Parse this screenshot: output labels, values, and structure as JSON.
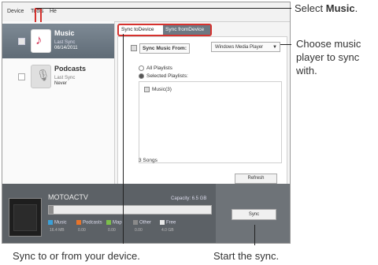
{
  "menu": [
    "Device",
    "Tools",
    "He"
  ],
  "sidebar": {
    "items": [
      {
        "title": "Music",
        "line1": "Last Sync",
        "line2": "06/14/2011"
      },
      {
        "title": "Podcasts",
        "line1": "Last Sync",
        "line2": "Never"
      }
    ]
  },
  "tabs": {
    "to_device": "Sync toDevice",
    "from_device": "Sync fromDevice"
  },
  "sync_panel": {
    "sync_from_label": "Sync Music From:",
    "player_value": "Windows Media Player",
    "all_playlists": "All Playlists",
    "selected_playlists": "Selected Playlists:",
    "playlist_item": "Music(3)",
    "song_count": "3 Songs",
    "refresh_button": "Refresh"
  },
  "device": {
    "name": "MOTOACTV",
    "capacity": "Capacity: 6.5 GB",
    "usage_fraction": 0.03,
    "legend": [
      {
        "label": "Music",
        "size": "16.4 MB",
        "color": "#3aa0d8"
      },
      {
        "label": "Podcasts",
        "size": "0.00",
        "color": "#e8742a"
      },
      {
        "label": "Map",
        "size": "0.00",
        "color": "#7cc04b"
      },
      {
        "label": "Other",
        "size": "0.00",
        "color": "#8a8a8a"
      },
      {
        "label": "Free",
        "size": "4.0 GB",
        "color": "#e8e8e8"
      }
    ],
    "sync_button": "Sync"
  },
  "callouts": {
    "select_prefix": "Select ",
    "select_bold": "Music",
    "select_suffix": ".",
    "choose_player": "Choose music player to sync with.",
    "sync_direction": "Sync to or from your device.",
    "start_sync": "Start the sync."
  },
  "colors": {
    "highlight": "#d6322e",
    "selected_item": "#6d7882"
  }
}
